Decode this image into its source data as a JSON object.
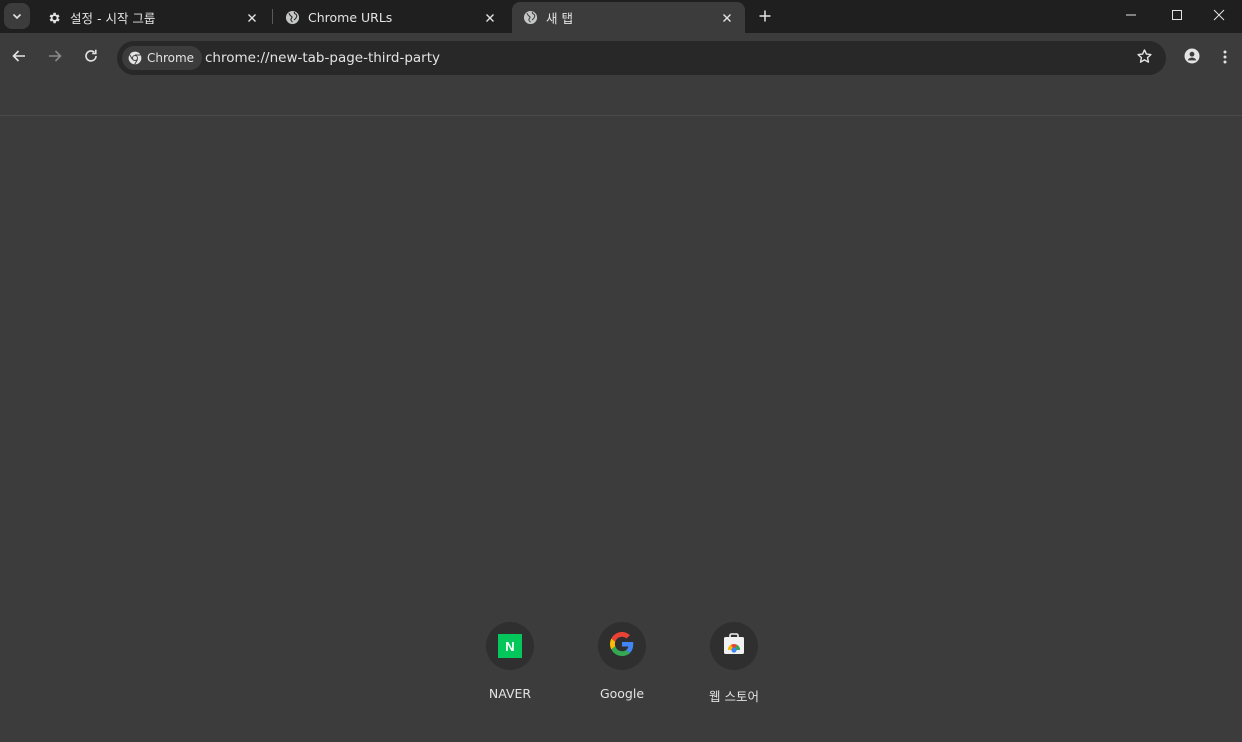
{
  "tabs": [
    {
      "title": "설정 - 시작 그룹",
      "icon": "gear-icon",
      "active": false
    },
    {
      "title": "Chrome URLs",
      "icon": "globe-icon",
      "active": false
    },
    {
      "title": "새 탭",
      "icon": "globe-icon",
      "active": true
    }
  ],
  "toolbar": {
    "site_chip_label": "Chrome",
    "url": "chrome://new-tab-page-third-party"
  },
  "shortcuts": [
    {
      "label": "NAVER",
      "icon": "naver-logo-icon",
      "logo_letter": "N"
    },
    {
      "label": "Google",
      "icon": "google-logo-icon"
    },
    {
      "label": "웹 스토어",
      "icon": "web-store-icon"
    }
  ],
  "colors": {
    "tabstrip_bg": "#1f1f1f",
    "toolbar_bg": "#3c3c3c",
    "omnibox_bg": "#282828",
    "naver_green": "#03c75a"
  }
}
